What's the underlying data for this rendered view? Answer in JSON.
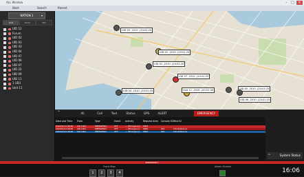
{
  "window": {
    "title": "ALL Window"
  },
  "menu": {
    "items": [
      "Start",
      "Search",
      "Recent"
    ]
  },
  "left_panel": {
    "selector": "NATION 1",
    "tabs": [
      "Unit",
      "Radio",
      "Talk"
    ],
    "units": [
      {
        "label": "UID 12",
        "color": "#e57373"
      },
      {
        "label": "Forum",
        "color": "#e57373"
      },
      {
        "label": "UID 02",
        "color": "#e57373"
      },
      {
        "label": "UID 03",
        "color": "#e57373"
      },
      {
        "label": "UID 43",
        "color": "#e57373"
      },
      {
        "label": "UID 04",
        "color": "#e57373"
      },
      {
        "label": "UID 07",
        "color": "#e57373"
      },
      {
        "label": "UID 06",
        "color": "#e57373"
      },
      {
        "label": "UID 07",
        "color": "#e57373"
      },
      {
        "label": "UID 22",
        "color": "#e57373"
      },
      {
        "label": "UID 09",
        "color": "#e57373"
      },
      {
        "label": "UID 11",
        "color": "#e57373"
      },
      {
        "label": "1 UD1",
        "color": "#e57373"
      },
      {
        "label": "Unit 11",
        "color": "#e57373"
      }
    ]
  },
  "map": {
    "labels": [
      {
        "text": "UID 09 ,2010 ,(20:01:25"
      },
      {
        "text": "UID 02 ,2010 ,(20:01:25"
      },
      {
        "text": "UID 01 ,2010 ,(20:01:25"
      },
      {
        "text": "UID 07 ,2010 ,(20:01:25"
      },
      {
        "text": "UID 04 ,2010 ,(20:01:25"
      },
      {
        "text": "Unit 11 ,2010 ,(20:01:30"
      },
      {
        "text": "UID 05 ,2010 ,(20:01:25"
      },
      {
        "text": "UID 06 ,2010 ,(20:01:25"
      }
    ]
  },
  "alert_filter": {
    "tabs": [
      "All",
      "Call",
      "Text",
      "Status",
      "GPS",
      "ALERT",
      "EMERGENCY"
    ]
  },
  "alert_table": {
    "headers": [
      "Date and Time",
      "From",
      "Type",
      "Event",
      "Activity",
      "Request Item",
      "Console ID",
      "Rest ID"
    ],
    "rows": [
      {
        "cells": [
          "2010/01/11 08:48",
          "UID 1001",
          "EMERGENCY",
          "OFF",
          "— (Emergency)",
          "0000",
          "",
          ""
        ],
        "color": "#c62828"
      },
      {
        "cells": [
          "2010/01/11 08:48",
          "UID 1001",
          "EMERGENCY",
          "OFF",
          "— (Emergency)",
          "0000",
          "001",
          "Info Reference"
        ],
        "color": "#9e1b1b"
      },
      {
        "cells": [
          "2010/01/11 08:48",
          "UID 1001",
          "EMERGENCY",
          "OFF",
          "— (Emergency)",
          "0000",
          "001",
          "Info Reference"
        ],
        "color": "#1e5fa8"
      }
    ]
  },
  "side": {
    "system_status": "System Status"
  },
  "bottom": {
    "emergency_label": "EMERGENCY",
    "front_map_label": "Front Map",
    "keys": [
      "1",
      "2",
      "3",
      "4"
    ],
    "alarm_label": "Alarm Screen",
    "clock": "16:06"
  }
}
